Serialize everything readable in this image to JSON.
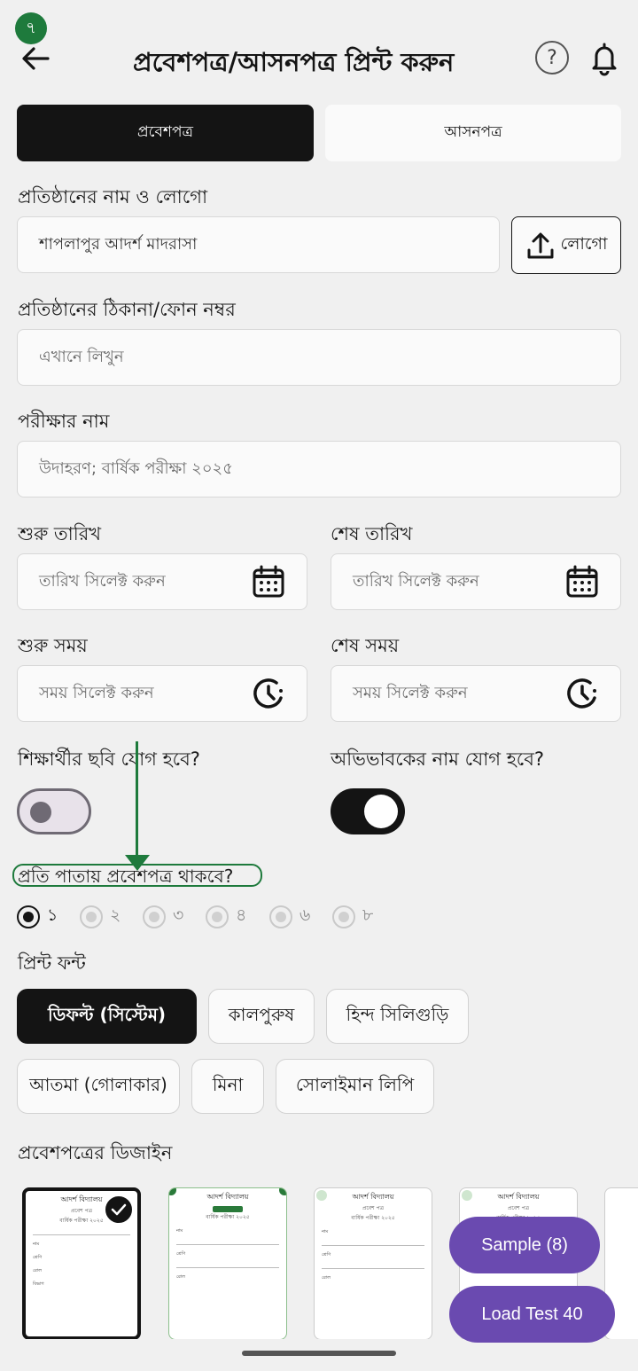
{
  "step_badge": "৭",
  "header": {
    "title": "প্রবেশপত্র/আসনপত্র প্রিন্ট করুন",
    "help_icon": "question-circle-icon",
    "bell_icon": "bell-icon"
  },
  "tabs": [
    {
      "label": "প্রবেশপত্র",
      "active": true
    },
    {
      "label": "আসনপত্র",
      "active": false
    }
  ],
  "institution": {
    "label": "প্রতিষ্ঠানের নাম ও লোগো",
    "value": "শাপলাপুর আদর্শ মাদরাসা",
    "logo_button": "লোগো"
  },
  "address": {
    "label": "প্রতিষ্ঠানের ঠিকানা/ফোন নম্বর",
    "placeholder": "এখানে লিখুন"
  },
  "exam": {
    "label": "পরীক্ষার নাম",
    "placeholder": "উদাহরণ; বার্ষিক পরীক্ষা ২০২৫"
  },
  "start_date": {
    "label": "শুরু তারিখ",
    "placeholder": "তারিখ সিলেক্ট করুন"
  },
  "end_date": {
    "label": "শেষ তারিখ",
    "placeholder": "তারিখ সিলেক্ট করুন"
  },
  "start_time": {
    "label": "শুরু সময়",
    "placeholder": "সময় সিলেক্ট করুন"
  },
  "end_time": {
    "label": "শেষ সময়",
    "placeholder": "সময় সিলেক্ট করুন"
  },
  "student_photo": {
    "label": "শিক্ষার্থীর ছবি যোগ হবে?",
    "on": false
  },
  "guardian_name": {
    "label": "অভিভাবকের নাম যোগ হবে?",
    "on": true
  },
  "per_page": {
    "label": "প্রতি পাতায় প্রবেশপত্র থাকবে?",
    "options": [
      "১",
      "২",
      "৩",
      "৪",
      "৬",
      "৮"
    ],
    "selected": "১"
  },
  "font": {
    "label": "প্রিন্ট ফন্ট",
    "options": [
      "ডিফল্ট (সিস্টেম)",
      "কালপুরুষ",
      "হিন্দ সিলিগুড়ি",
      "আতমা (গোলাকার)",
      "মিনা",
      "সোলাইমান লিপি"
    ],
    "selected": "ডিফল্ট (সিস্টেম)"
  },
  "design": {
    "label": "প্রবেশপত্রের ডিজাইন",
    "card_title": "আদর্শ বিদ্যালয়",
    "card_sub": "প্রবেশ পত্র",
    "card_exam": "বার্ষিক পরীক্ষা ২০২৫",
    "card_rows": [
      "নাম",
      "শ্রেণি",
      "রোল",
      "বিভাগ"
    ]
  },
  "fab": {
    "sample": "Sample (8)",
    "load_test": "Load Test 40"
  }
}
